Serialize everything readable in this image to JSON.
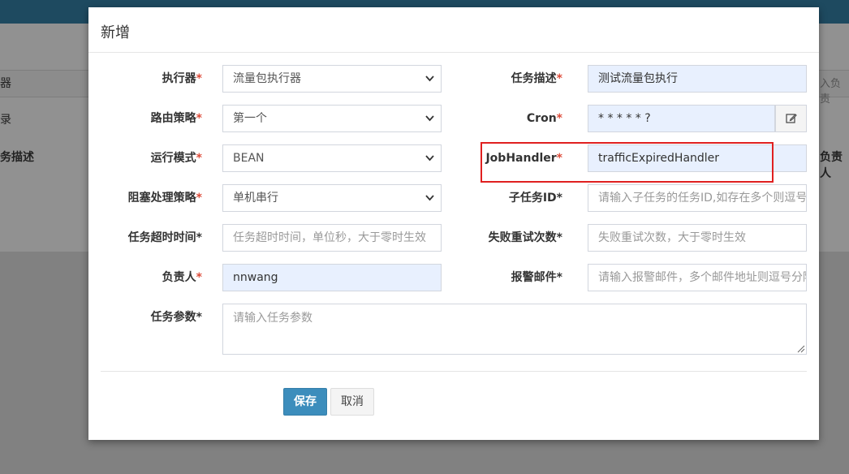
{
  "background": {
    "col1_header_fragment": "器",
    "col1_row_fragment": "录",
    "col1_desc_fragment": "务描述",
    "right_input_fragment": "入负责",
    "right_header_fragment": "负责人"
  },
  "modal": {
    "title": "新增",
    "fields": {
      "executor": {
        "label": "执行器",
        "required": "*",
        "value": "流量包执行器"
      },
      "job_desc": {
        "label": "任务描述",
        "required": "*",
        "value": "测试流量包执行"
      },
      "route_strategy": {
        "label": "路由策略",
        "required": "*",
        "value": "第一个"
      },
      "cron": {
        "label": "Cron",
        "required": "*",
        "value": "* * * * * ?"
      },
      "run_mode": {
        "label": "运行模式",
        "required": "*",
        "value": "BEAN"
      },
      "job_handler": {
        "label": "JobHandler",
        "required": "*",
        "value": "trafficExpiredHandler"
      },
      "block_strategy": {
        "label": "阻塞处理策略",
        "required": "*",
        "value": "单机串行"
      },
      "child_job_id": {
        "label": "子任务ID*",
        "placeholder": "请输入子任务的任务ID,如存在多个则逗号分隔"
      },
      "timeout": {
        "label": "任务超时时间*",
        "placeholder": "任务超时时间，单位秒，大于零时生效"
      },
      "retry_count": {
        "label": "失败重试次数*",
        "placeholder": "失败重试次数，大于零时生效"
      },
      "author": {
        "label": "负责人",
        "required": "*",
        "value": "nnwang"
      },
      "alarm_email": {
        "label": "报警邮件*",
        "placeholder": "请输入报警邮件，多个邮件地址则逗号分隔"
      },
      "job_param": {
        "label": "任务参数*",
        "placeholder": "请输入任务参数"
      }
    },
    "buttons": {
      "save": "保存",
      "cancel": "取消"
    }
  },
  "colors": {
    "primary": "#3c8dbc",
    "required": "#dd4b39",
    "highlight": "#e02020",
    "autofill": "#e8f0fe"
  },
  "icons": {
    "select_arrow": "chevron-down-icon",
    "cron_edit": "edit-icon",
    "textarea_resize": "resize-handle-icon"
  }
}
